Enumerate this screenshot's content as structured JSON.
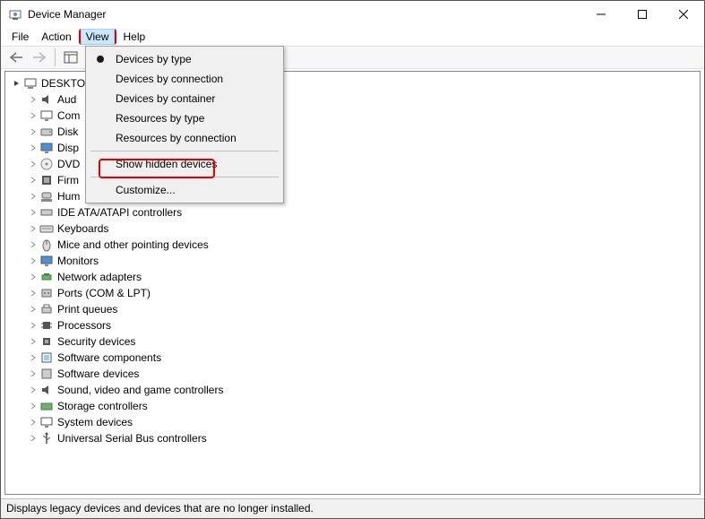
{
  "title": "Device Manager",
  "menu": {
    "file": "File",
    "action": "Action",
    "view": "View",
    "help": "Help"
  },
  "dropdown": {
    "devices_by_type": "Devices by type",
    "devices_by_connection": "Devices by connection",
    "devices_by_container": "Devices by container",
    "resources_by_type": "Resources by type",
    "resources_by_connection": "Resources by connection",
    "show_hidden": "Show hidden devices",
    "customize": "Customize..."
  },
  "root": "DESKTO",
  "tree": {
    "n0": "Aud",
    "n1": "Com",
    "n2": "Disk",
    "n3": "Disp",
    "n4": "DVD",
    "n5": "Firm",
    "n6": "Hum",
    "n7": "IDE ATA/ATAPI controllers",
    "n8": "Keyboards",
    "n9": "Mice and other pointing devices",
    "n10": "Monitors",
    "n11": "Network adapters",
    "n12": "Ports (COM & LPT)",
    "n13": "Print queues",
    "n14": "Processors",
    "n15": "Security devices",
    "n16": "Software components",
    "n17": "Software devices",
    "n18": "Sound, video and game controllers",
    "n19": "Storage controllers",
    "n20": "System devices",
    "n21": "Universal Serial Bus controllers"
  },
  "status": "Displays legacy devices and devices that are no longer installed."
}
